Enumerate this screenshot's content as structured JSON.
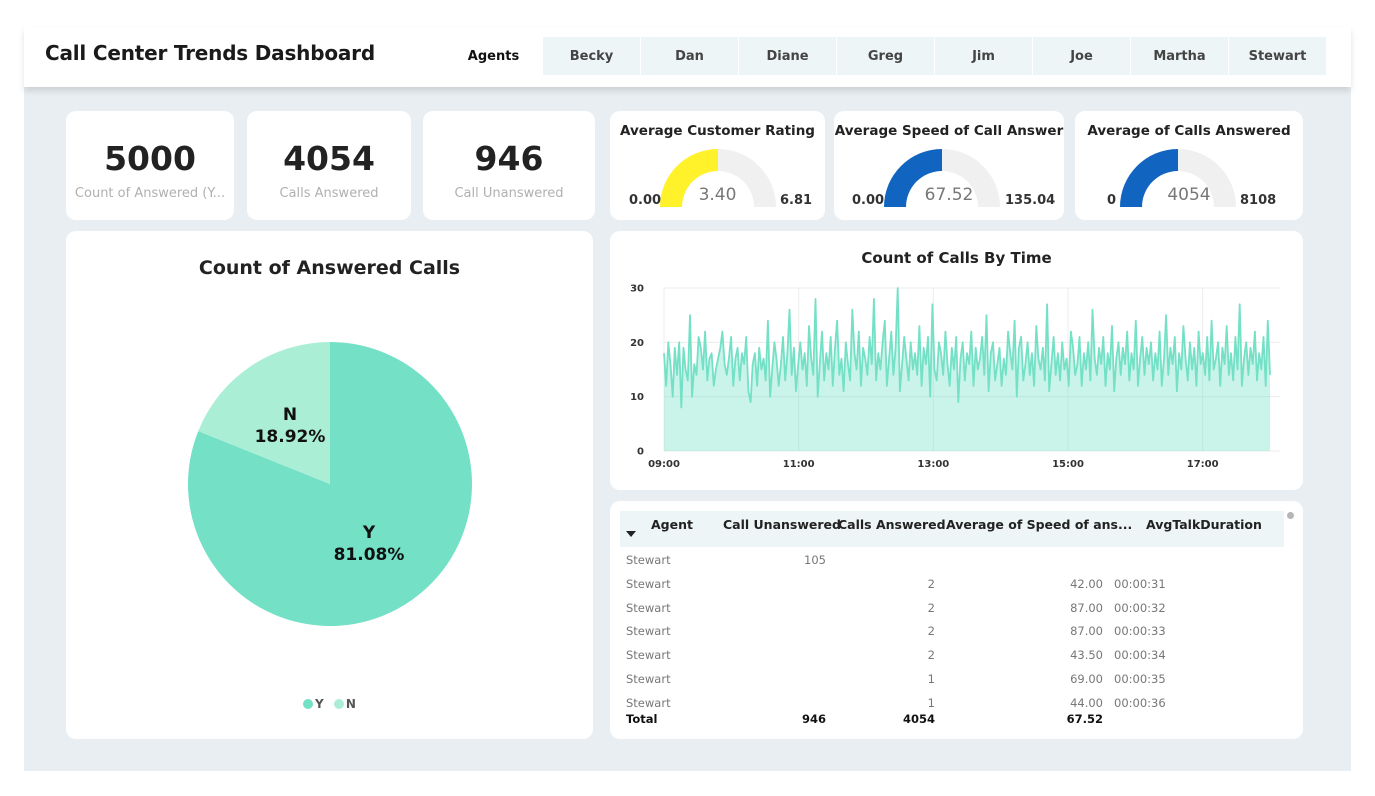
{
  "header": {
    "title": "Call Center Trends Dashboard",
    "tabs": [
      {
        "label": "Agents",
        "active": true
      },
      {
        "label": "Becky"
      },
      {
        "label": "Dan"
      },
      {
        "label": "Diane"
      },
      {
        "label": "Greg"
      },
      {
        "label": "Jim"
      },
      {
        "label": "Joe"
      },
      {
        "label": "Martha"
      },
      {
        "label": "Stewart"
      }
    ]
  },
  "kpis": [
    {
      "value": "5000",
      "label": "Count of Answered (Y..."
    },
    {
      "value": "4054",
      "label": "Calls Answered"
    },
    {
      "value": "946",
      "label": "Call Unanswered"
    }
  ],
  "gauges": [
    {
      "title": "Average Customer Rating",
      "min": "0.00",
      "max": "6.81",
      "value": "3.40",
      "fraction": 0.5,
      "color": "#fff12a"
    },
    {
      "title": "Average Speed of Call Answer",
      "min": "0.00",
      "max": "135.04",
      "value": "67.52",
      "fraction": 0.5,
      "color": "#1165c1"
    },
    {
      "title": "Average of Calls Answered",
      "min": "0",
      "max": "8108",
      "value": "4054",
      "fraction": 0.5,
      "color": "#1165c1"
    }
  ],
  "pie": {
    "title": "Count of Answered Calls",
    "slices": [
      {
        "name": "Y",
        "percent": 81.08,
        "label": "81.08%",
        "color": "#74e0c6"
      },
      {
        "name": "N",
        "percent": 18.92,
        "label": "18.92%",
        "color": "#aaeed6"
      }
    ],
    "legend": [
      "Y",
      "N"
    ]
  },
  "chart_data": {
    "type": "area",
    "title": "Count of Calls By Time",
    "x_range": [
      "09:00",
      "18:00"
    ],
    "x_ticks": [
      "09:00",
      "11:00",
      "13:00",
      "15:00",
      "17:00"
    ],
    "y_ticks": [
      "0",
      "10",
      "20",
      "30"
    ],
    "ylim": [
      0,
      30
    ],
    "color": "#74e0c6",
    "values": [
      18,
      12,
      20,
      16,
      10,
      19,
      14,
      20,
      8,
      19,
      15,
      13,
      25,
      10,
      16,
      14,
      21,
      19,
      15,
      22,
      13,
      17,
      18,
      12,
      15,
      17,
      19,
      22,
      16,
      14,
      17,
      21,
      12,
      17,
      19,
      13,
      18,
      16,
      21,
      11,
      9,
      16,
      18,
      12,
      19,
      15,
      17,
      13,
      24,
      10,
      15,
      20,
      17,
      12,
      16,
      21,
      13,
      18,
      26,
      14,
      19,
      11,
      16,
      20,
      15,
      18,
      12,
      23,
      17,
      14,
      28,
      10,
      16,
      22,
      13,
      18,
      15,
      21,
      12,
      19,
      24,
      14,
      17,
      11,
      20,
      16,
      13,
      26,
      18,
      15,
      22,
      12,
      19,
      17,
      14,
      21,
      16,
      28,
      13,
      18,
      15,
      20,
      24,
      12,
      17,
      22,
      14,
      19,
      30,
      11,
      16,
      21,
      17,
      13,
      20,
      15,
      18,
      14,
      23,
      12,
      19,
      16,
      21,
      10,
      27,
      15,
      13,
      20,
      18,
      14,
      22,
      16,
      12,
      19,
      15,
      21,
      9,
      17,
      20,
      13,
      18,
      16,
      22,
      12,
      19,
      15,
      17,
      21,
      14,
      25,
      11,
      18,
      20,
      13,
      16,
      19,
      12,
      17,
      14,
      22,
      18,
      15,
      24,
      10,
      19,
      21,
      13,
      16,
      20,
      14,
      18,
      12,
      23,
      17,
      15,
      19,
      13,
      27,
      11,
      16,
      21,
      14,
      18,
      13,
      20,
      15,
      17,
      12,
      22,
      19,
      14,
      16,
      21,
      12,
      18,
      15,
      20,
      13,
      26,
      17,
      14,
      19,
      16,
      21,
      12,
      18,
      15,
      23,
      11,
      17,
      20,
      14,
      19,
      16,
      22,
      13,
      18,
      15,
      24,
      12,
      17,
      21,
      14,
      19,
      16,
      20,
      13,
      18,
      15,
      22,
      12,
      17,
      25,
      14,
      19,
      16,
      21,
      11,
      18,
      15,
      23,
      17,
      13,
      20,
      15,
      19,
      12,
      22,
      16,
      18,
      14,
      21,
      13,
      24,
      15,
      17,
      20,
      12,
      19,
      16,
      23,
      14,
      18,
      13,
      21,
      15,
      27,
      12,
      17,
      20,
      14,
      19,
      16,
      22,
      13,
      18,
      15,
      21,
      12,
      24,
      14
    ]
  },
  "table": {
    "columns": [
      "Agent",
      "Call Unanswered",
      "Calls Answered",
      "Average of Speed of ans...",
      "AvgTalkDuration"
    ],
    "rows": [
      {
        "agent": "Stewart",
        "unanswered": "105",
        "answered": "",
        "speed": "",
        "talk": ""
      },
      {
        "agent": "Stewart",
        "unanswered": "",
        "answered": "2",
        "speed": "42.00",
        "talk": "00:00:31"
      },
      {
        "agent": "Stewart",
        "unanswered": "",
        "answered": "2",
        "speed": "87.00",
        "talk": "00:00:32"
      },
      {
        "agent": "Stewart",
        "unanswered": "",
        "answered": "2",
        "speed": "87.00",
        "talk": "00:00:33"
      },
      {
        "agent": "Stewart",
        "unanswered": "",
        "answered": "2",
        "speed": "43.50",
        "talk": "00:00:34"
      },
      {
        "agent": "Stewart",
        "unanswered": "",
        "answered": "1",
        "speed": "69.00",
        "talk": "00:00:35"
      },
      {
        "agent": "Stewart",
        "unanswered": "",
        "answered": "1",
        "speed": "44.00",
        "talk": "00:00:36"
      }
    ],
    "total": {
      "label": "Total",
      "unanswered": "946",
      "answered": "4054",
      "speed": "67.52",
      "talk": ""
    }
  }
}
